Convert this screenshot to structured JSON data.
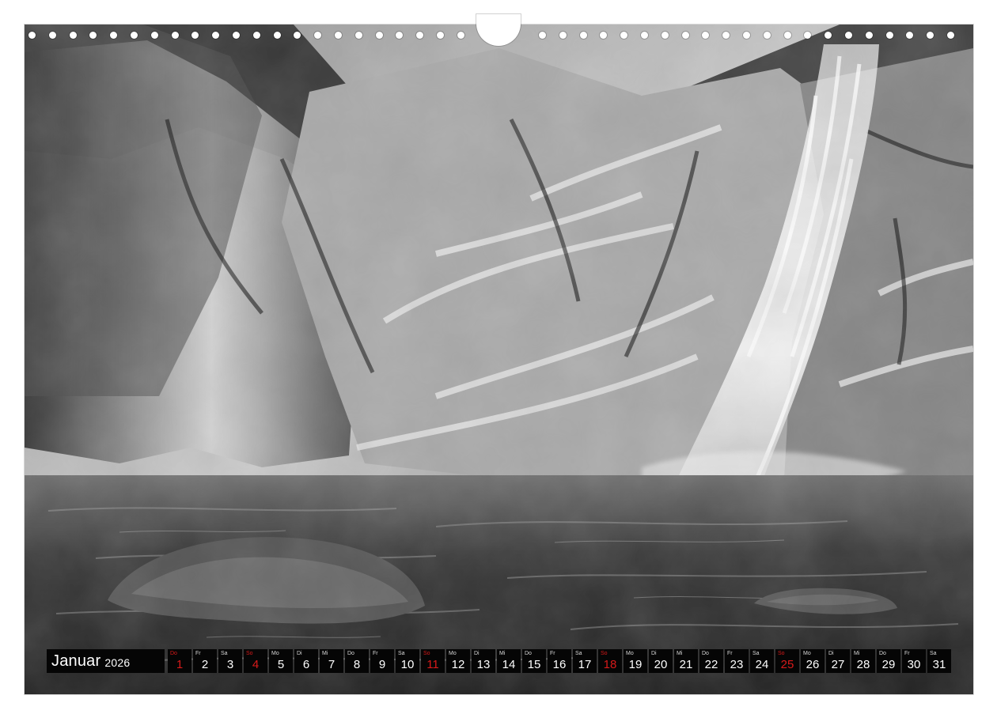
{
  "calendar": {
    "month": "Januar",
    "year": "2026",
    "days": [
      {
        "weekday": "Do",
        "day": "1",
        "red": true
      },
      {
        "weekday": "Fr",
        "day": "2",
        "red": false
      },
      {
        "weekday": "Sa",
        "day": "3",
        "red": false
      },
      {
        "weekday": "So",
        "day": "4",
        "red": true
      },
      {
        "weekday": "Mo",
        "day": "5",
        "red": false
      },
      {
        "weekday": "Di",
        "day": "6",
        "red": false
      },
      {
        "weekday": "Mi",
        "day": "7",
        "red": false
      },
      {
        "weekday": "Do",
        "day": "8",
        "red": false
      },
      {
        "weekday": "Fr",
        "day": "9",
        "red": false
      },
      {
        "weekday": "Sa",
        "day": "10",
        "red": false
      },
      {
        "weekday": "So",
        "day": "11",
        "red": true
      },
      {
        "weekday": "Mo",
        "day": "12",
        "red": false
      },
      {
        "weekday": "Di",
        "day": "13",
        "red": false
      },
      {
        "weekday": "Mi",
        "day": "14",
        "red": false
      },
      {
        "weekday": "Do",
        "day": "15",
        "red": false
      },
      {
        "weekday": "Fr",
        "day": "16",
        "red": false
      },
      {
        "weekday": "Sa",
        "day": "17",
        "red": false
      },
      {
        "weekday": "So",
        "day": "18",
        "red": true
      },
      {
        "weekday": "Mo",
        "day": "19",
        "red": false
      },
      {
        "weekday": "Di",
        "day": "20",
        "red": false
      },
      {
        "weekday": "Mi",
        "day": "21",
        "red": false
      },
      {
        "weekday": "Do",
        "day": "22",
        "red": false
      },
      {
        "weekday": "Fr",
        "day": "23",
        "red": false
      },
      {
        "weekday": "Sa",
        "day": "24",
        "red": false
      },
      {
        "weekday": "So",
        "day": "25",
        "red": true
      },
      {
        "weekday": "Mo",
        "day": "26",
        "red": false
      },
      {
        "weekday": "Di",
        "day": "27",
        "red": false
      },
      {
        "weekday": "Mi",
        "day": "28",
        "red": false
      },
      {
        "weekday": "Do",
        "day": "29",
        "red": false
      },
      {
        "weekday": "Fr",
        "day": "30",
        "red": false
      },
      {
        "weekday": "Sa",
        "day": "31",
        "red": false
      }
    ]
  },
  "colors": {
    "strip_background": "#050505",
    "strip_text": "#ffffff",
    "holiday_red": "#d81a1a"
  },
  "photo": {
    "style": "black-and-white landscape",
    "elements": [
      "rock-face",
      "waterfall",
      "pool-water",
      "stones"
    ]
  }
}
